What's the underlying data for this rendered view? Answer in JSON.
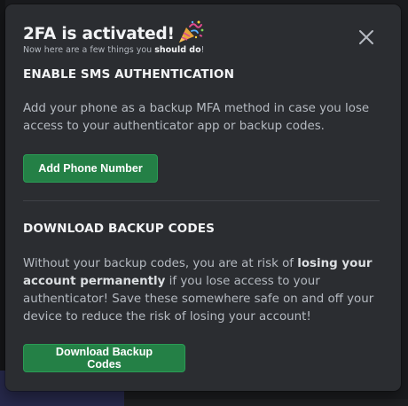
{
  "modal": {
    "title": "2FA is activated!",
    "subtitle_prefix": "Now here are a few things you ",
    "subtitle_bold": "should do",
    "subtitle_suffix": "!"
  },
  "sms_section": {
    "title": "ENABLE SMS AUTHENTICATION",
    "text": "Add your phone as a backup MFA method in case you lose access to your authenticator app or backup codes.",
    "button_label": "Add Phone Number"
  },
  "backup_section": {
    "title": "DOWNLOAD BACKUP CODES",
    "text_part1": "Without your backup codes, you are at risk of ",
    "text_bold": "losing your account permanently",
    "text_part2": " if you lose access to your authenticator! Save these somewhere safe on and off your device to reduce the risk of losing your account!",
    "button_label": "Download Backup Codes"
  },
  "icons": {
    "title_icon": "party-popper-icon",
    "close": "close-icon"
  },
  "colors": {
    "modal_bg": "#2b2d31",
    "button_green": "#248046",
    "heading": "#f2f3f5",
    "body_text": "#b5bac1"
  }
}
